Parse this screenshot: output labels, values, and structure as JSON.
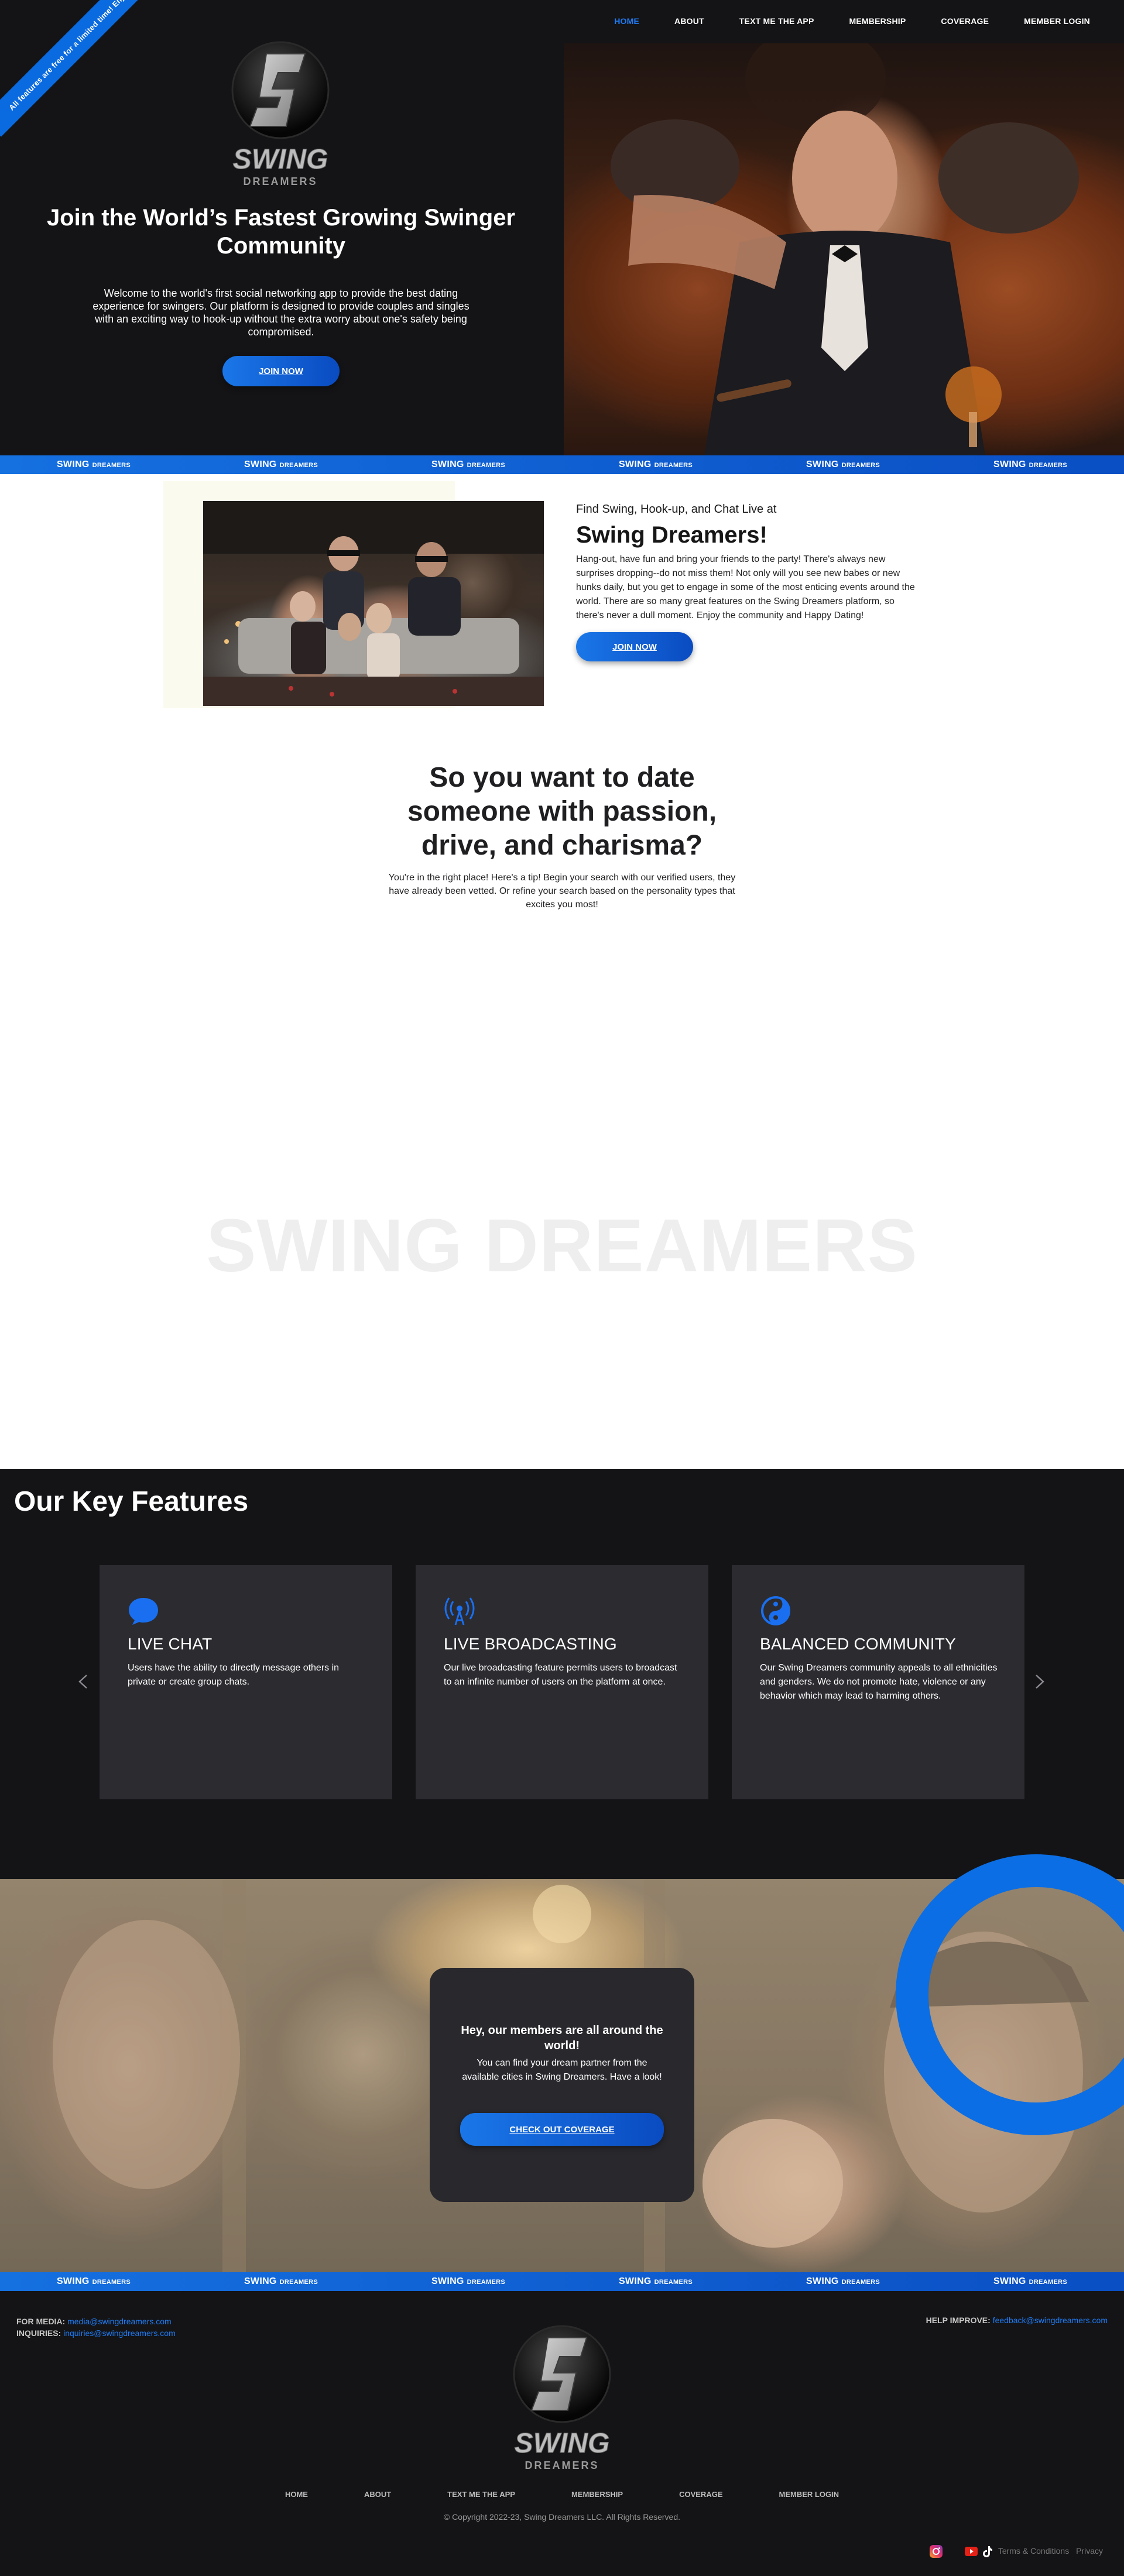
{
  "ribbon": {
    "text": "All features are free for a limited time! Enjoy!"
  },
  "nav": {
    "items": [
      {
        "label": "HOME"
      },
      {
        "label": "ABOUT"
      },
      {
        "label": "TEXT ME THE APP"
      },
      {
        "label": "MEMBERSHIP"
      },
      {
        "label": "COVERAGE"
      },
      {
        "label": "MEMBER LOGIN"
      }
    ],
    "active_color": "#1f7bf5"
  },
  "brand": {
    "logo_word": "SWING",
    "logo_sub": "DREAMERS",
    "accent_color": "#0a6ae0"
  },
  "hero": {
    "title": "Join the World’s Fastest Growing Swinger Community",
    "text": "Welcome to the world's first social networking app to provide the best dating experience for swingers. Our platform is designed to provide couples and singles with an exciting way to hook-up without the extra worry about one's safety being compromised.",
    "button": "JOIN NOW"
  },
  "strip": {
    "word": "SWING",
    "sub": "DREAMERS"
  },
  "about": {
    "kicker": "Find Swing, Hook-up, and Chat Live at",
    "title": "Swing Dreamers!",
    "text": "Hang-out, have fun and bring your friends to the party! There's always new surprises dropping--do not miss them! Not only will you see new babes or new hunks daily, but you get to engage in some of the most enticing events around the world. There are so many great features on the Swing Dreamers platform, so there's never a dull moment. Enjoy the community and Happy Dating!",
    "button": "JOIN NOW"
  },
  "date_section": {
    "title": "So you want to date someone with passion, drive, and charisma?",
    "text": "You're in the right place! Here's a tip! Begin your search with our verified users, they have already been vetted. Or refine your search based on the personality types that excites you most!",
    "watermark": "SWING DREAMERS"
  },
  "features": {
    "title": "Our Key Features",
    "cards": [
      {
        "icon": "chat-bubble-icon",
        "title": "LIVE CHAT",
        "text": "Users have the ability to directly message others in private or create group chats."
      },
      {
        "icon": "broadcast-icon",
        "title": "LIVE BROADCASTING",
        "text": "Our live broadcasting feature permits users to broadcast to an infinite number of users on the platform at once."
      },
      {
        "icon": "yin-yang-icon",
        "title": "BALANCED COMMUNITY",
        "text": "Our Swing Dreamers community appeals to all ethnicities and genders. We do not promote hate, violence or any behavior which may lead to harming others."
      }
    ]
  },
  "coverage": {
    "title": "Hey, our members are all around the world!",
    "text": "You can find your dream partner from the available cities in Swing Dreamers. Have a look!",
    "button": "CHECK OUT COVERAGE"
  },
  "footer": {
    "media_label": "FOR MEDIA:",
    "media_email": "media@swingdreamers.com",
    "inquiries_label": "INQUIRIES:",
    "inquiries_email": "inquiries@swingdreamers.com",
    "help_label": "HELP IMPROVE:",
    "help_email": "feedback@swingdreamers.com",
    "nav": [
      {
        "label": "HOME"
      },
      {
        "label": "ABOUT"
      },
      {
        "label": "TEXT ME THE APP"
      },
      {
        "label": "MEMBERSHIP"
      },
      {
        "label": "COVERAGE"
      },
      {
        "label": "MEMBER LOGIN"
      }
    ],
    "copyright": "© Copyright 2022-23, Swing Dreamers LLC. All Rights Reserved.",
    "terms": "Terms & Conditions",
    "privacy": "Privacy",
    "social": [
      "instagram-icon",
      "youtube-icon",
      "tiktok-icon"
    ]
  }
}
